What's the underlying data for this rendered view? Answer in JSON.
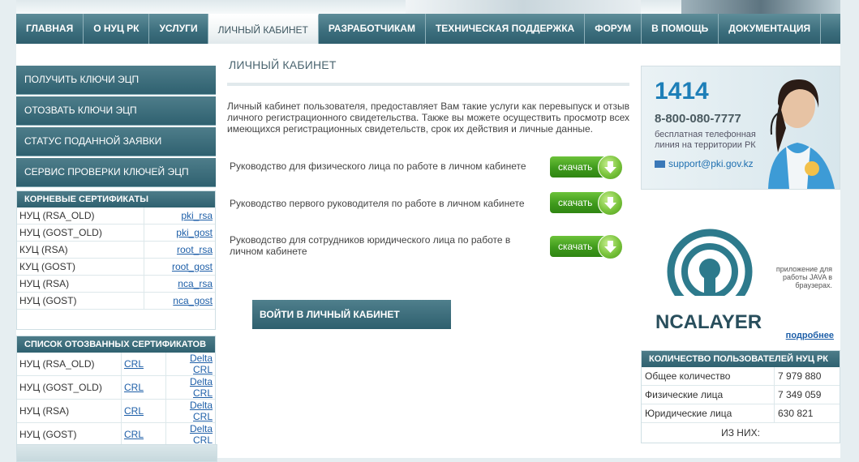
{
  "nav": {
    "items": [
      {
        "label": "ГЛАВНАЯ",
        "active": false
      },
      {
        "label": "О НУЦ РК",
        "active": false
      },
      {
        "label": "УСЛУГИ",
        "active": false
      },
      {
        "label": "ЛИЧНЫЙ КАБИНЕТ",
        "active": true
      },
      {
        "label": "РАЗРАБОТЧИКАМ",
        "active": false
      },
      {
        "label": "ТЕХНИЧЕСКАЯ ПОДДЕРЖКА",
        "active": false
      },
      {
        "label": "ФОРУМ",
        "active": false
      },
      {
        "label": "В ПОМОЩЬ",
        "active": false
      },
      {
        "label": "ДОКУМЕНТАЦИЯ",
        "active": false
      }
    ]
  },
  "sidebar": {
    "buttons": [
      "ПОЛУЧИТЬ КЛЮЧИ ЭЦП",
      "ОТОЗВАТЬ КЛЮЧИ ЭЦП",
      "СТАТУС ПОДАННОЙ ЗАЯВКИ",
      "СЕРВИС ПРОВЕРКИ КЛЮЧЕЙ ЭЦП"
    ],
    "root_certs": {
      "title": "КОРНЕВЫЕ СЕРТИФИКАТЫ",
      "rows": [
        {
          "name": "НУЦ (RSA_OLD)",
          "link": "pki_rsa"
        },
        {
          "name": "НУЦ (GOST_OLD)",
          "link": "pki_gost"
        },
        {
          "name": "КУЦ (RSA)",
          "link": "root_rsa"
        },
        {
          "name": "КУЦ (GOST)",
          "link": "root_gost"
        },
        {
          "name": "НУЦ (RSA)",
          "link": "nca_rsa"
        },
        {
          "name": "НУЦ (GOST)",
          "link": "nca_gost"
        }
      ]
    },
    "revoked": {
      "title": "СПИСОК ОТОЗВАННЫХ СЕРТИФИКАТОВ",
      "rows": [
        {
          "name": "НУЦ (RSA_OLD)",
          "crl": "CRL",
          "delta": "Delta CRL"
        },
        {
          "name": "НУЦ (GOST_OLD)",
          "crl": "CRL",
          "delta": "Delta CRL"
        },
        {
          "name": "НУЦ (RSA)",
          "crl": "CRL",
          "delta": "Delta CRL"
        },
        {
          "name": "НУЦ (GOST)",
          "crl": "CRL",
          "delta": "Delta CRL"
        }
      ]
    }
  },
  "main": {
    "title": "ЛИЧНЫЙ КАБИНЕТ",
    "intro": "Личный кабинет пользователя, предоставляет Вам такие услуги как перевыпуск и отзыв личного регистрационного свидетельства. Также вы можете осуществить просмотр всех имеющихся регистрационных свидетельств, срок их действия и личные данные.",
    "downloads": [
      {
        "text": "Руководство для физического лица по работе в личном кабинете",
        "button": "скачать"
      },
      {
        "text": "Руководство первого руководителя по работе в личном кабинете",
        "button": "скачать"
      },
      {
        "text": "Руководство для сотрудников юридического лица по работе в личном кабинете",
        "button": "скачать"
      }
    ],
    "login_button": "ВОЙТИ В ЛИЧНЫЙ КАБИНЕТ"
  },
  "right": {
    "promo": {
      "short_number": "1414",
      "phone": "8-800-080-7777",
      "free_line": "бесплатная телефонная линия на территории РК",
      "email": "support@pki.gov.kz"
    },
    "ncalayer": {
      "logo_text": "NCALAYER",
      "caption": "приложение для работы JAVA в браузерах.",
      "more_link": "подробнее"
    },
    "stats": {
      "title": "КОЛИЧЕСТВО ПОЛЬЗОВАТЕЛЕЙ НУЦ РК",
      "rows": [
        {
          "label": "Общее количество",
          "value": "7 979 880"
        },
        {
          "label": "Физические лица",
          "value": "7 349 059"
        },
        {
          "label": "Юридические лица",
          "value": "630 821"
        }
      ],
      "footer": "ИЗ НИХ:"
    }
  },
  "colors": {
    "nav_bg": "#3b6d7c",
    "accent_green": "#4fa825",
    "link_blue": "#1e5fa8",
    "brand_blue": "#1e7fb8"
  }
}
